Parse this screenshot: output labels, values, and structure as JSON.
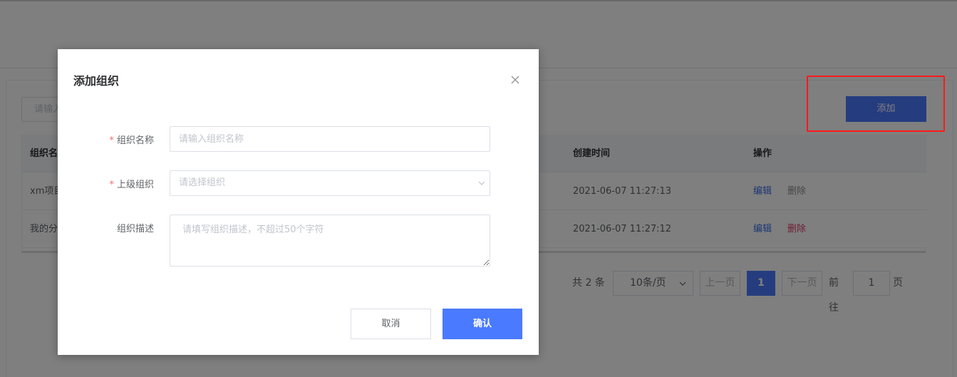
{
  "background": {
    "search": {
      "placeholder": "请输入"
    },
    "add_button": "添加",
    "table": {
      "columns": {
        "name": "组织名",
        "created": "创建时间",
        "actions": "操作"
      },
      "rows": [
        {
          "name": "xm项目",
          "created": "2021-06-07 11:27:13",
          "edit": "编辑",
          "delete": "删除",
          "delete_color": "#8c8c8c"
        },
        {
          "name": "我的分",
          "created": "2021-06-07 11:27:12",
          "edit": "编辑",
          "delete": "删除",
          "delete_color": "#e23b6e"
        }
      ]
    },
    "pagination": {
      "total": "共 2 条",
      "page_size": "10条/页",
      "prev": "上一页",
      "current": "1",
      "next": "下一页",
      "goto_label": "前往",
      "goto_value": "1",
      "page_suffix": "页"
    },
    "highlight_color": "#ff1a1a"
  },
  "dialog": {
    "title": "添加组织",
    "close_icon": "close-icon",
    "fields": {
      "name": {
        "required_mark": "*",
        "label": "组织名称",
        "placeholder": "请输入组织名称",
        "value": ""
      },
      "parent": {
        "required_mark": "*",
        "label": "上级组织",
        "placeholder": "请选择组织",
        "value": ""
      },
      "description": {
        "label": "组织描述",
        "placeholder": "请填写组织描述，不超过50个字符",
        "value": ""
      }
    },
    "buttons": {
      "cancel": "取消",
      "confirm": "确认"
    }
  },
  "colors": {
    "primary": "#4a7aff",
    "required": "#f56c6c",
    "mask": "rgba(0,0,0,0.5)"
  }
}
